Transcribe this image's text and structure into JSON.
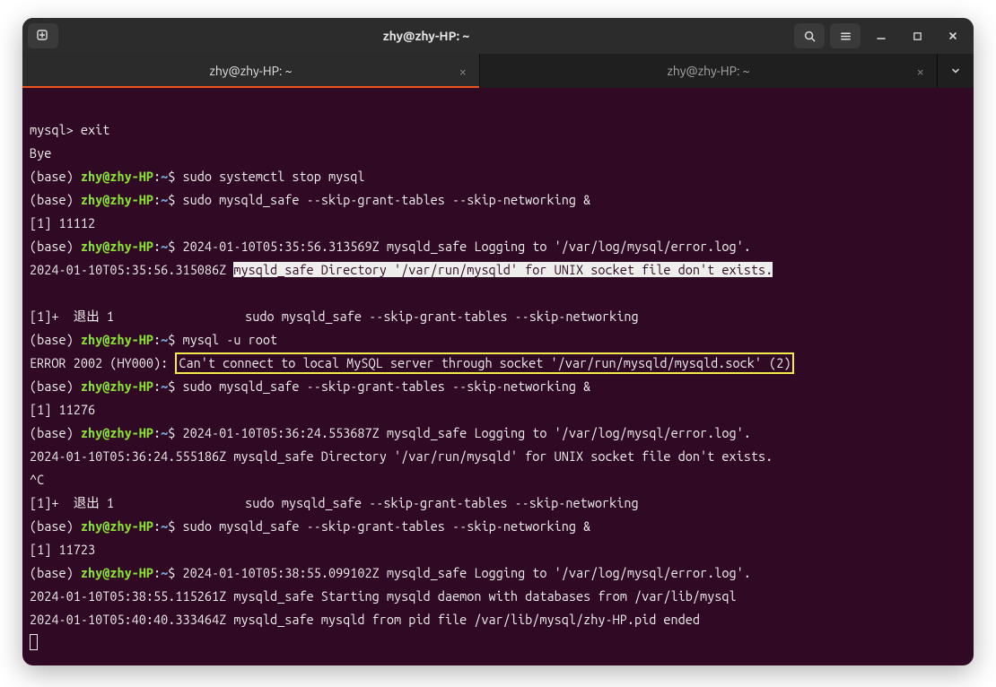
{
  "window": {
    "title": "zhy@zhy-HP: ~"
  },
  "tabs": [
    {
      "label": "zhy@zhy-HP: ~",
      "active": true
    },
    {
      "label": "zhy@zhy-HP: ~",
      "active": false
    }
  ],
  "prompt": {
    "base": "(base) ",
    "user": "zhy@zhy-HP",
    "sep": ":",
    "path": "~",
    "dollar": "$ "
  },
  "lines": {
    "l00": "",
    "l01": "mysql> exit",
    "l02": "Bye",
    "cmd1": "sudo systemctl stop mysql",
    "cmd2": "sudo mysqld_safe --skip-grant-tables --skip-networking &",
    "l05": "[1] 11112",
    "cmd3a": "2024-01-10T05:35:56.313569Z mysqld_safe Logging to '/var/log/mysql/error.log'.",
    "l07a": "2024-01-10T05:35:56.315086Z ",
    "l07b": "mysqld_safe Directory '/var/run/mysqld' for UNIX socket file don't exists.",
    "l08": "",
    "l09": "[1]+  退出 1                  sudo mysqld_safe --skip-grant-tables --skip-networking",
    "cmd4": "mysql -u root",
    "l11a": "ERROR 2002 (HY000): ",
    "l11b": "Can't connect to local MySQL server through socket '/var/run/mysqld/mysqld.sock' (2)",
    "cmd5": "sudo mysqld_safe --skip-grant-tables --skip-networking &",
    "l13": "[1] 11276",
    "cmd6a": "2024-01-10T05:36:24.553687Z mysqld_safe Logging to '/var/log/mysql/error.log'.",
    "l15": "2024-01-10T05:36:24.555186Z mysqld_safe Directory '/var/run/mysqld' for UNIX socket file don't exists.",
    "l16": "^C",
    "l17": "[1]+  退出 1                  sudo mysqld_safe --skip-grant-tables --skip-networking",
    "cmd7": "sudo mysqld_safe --skip-grant-tables --skip-networking &",
    "l19": "[1] 11723",
    "cmd8a": "2024-01-10T05:38:55.099102Z mysqld_safe Logging to '/var/log/mysql/error.log'.",
    "l21": "2024-01-10T05:38:55.115261Z mysqld_safe Starting mysqld daemon with databases from /var/lib/mysql",
    "l22": "2024-01-10T05:40:40.333464Z mysqld_safe mysqld from pid file /var/lib/mysql/zhy-HP.pid ended"
  }
}
